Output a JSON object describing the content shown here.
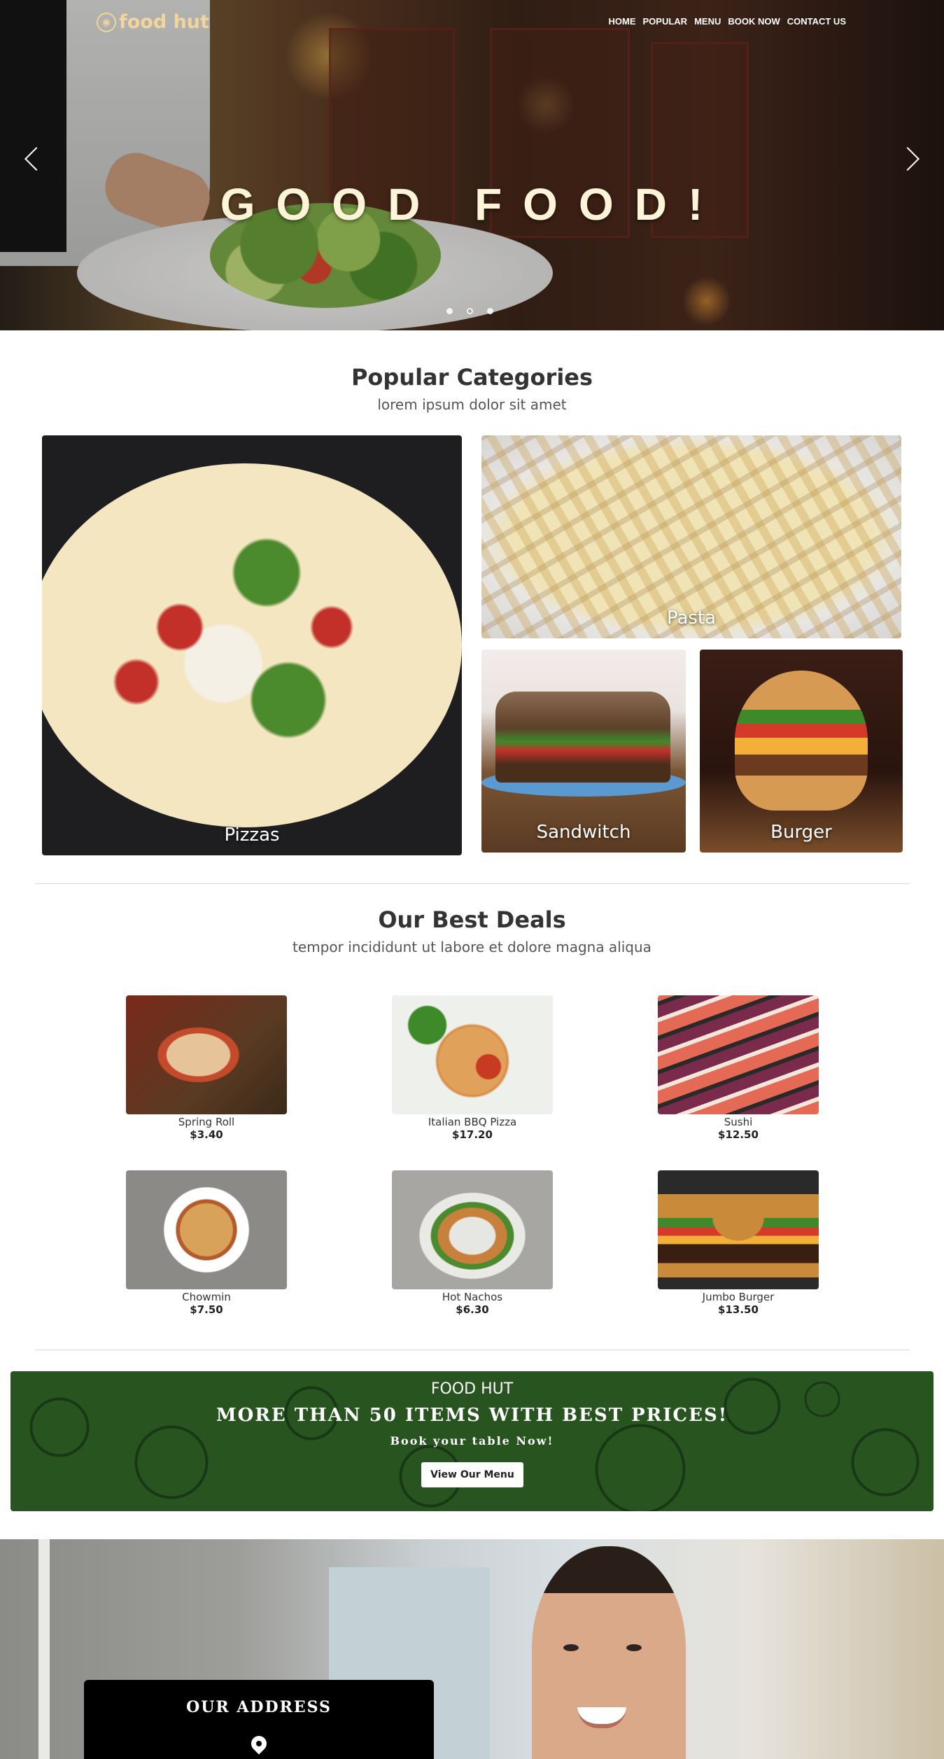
{
  "brand": {
    "logo_text": "food hut",
    "logo_icon": "chef-hat-icon",
    "accent": "#f3d49a"
  },
  "nav": {
    "items": [
      "HOME",
      "POPULAR",
      "MENU",
      "BOOK NOW",
      "CONTACT US"
    ]
  },
  "hero": {
    "title": "GOOD FOOD!",
    "slides": 3,
    "active_slide": 2
  },
  "popular": {
    "title": "Popular Categories",
    "subtitle": "lorem ipsum dolor sit amet",
    "categories": [
      "Pizzas",
      "Pasta",
      "Sandwitch",
      "Burger"
    ]
  },
  "deals": {
    "title": "Our Best Deals",
    "subtitle": "tempor incididunt ut labore et dolore magna aliqua",
    "items": [
      {
        "name": "Spring Roll",
        "price": "$3.40"
      },
      {
        "name": "Italian BBQ Pizza",
        "price": "$17.20"
      },
      {
        "name": "Sushi",
        "price": "$12.50"
      },
      {
        "name": "Chowmin",
        "price": "$7.50"
      },
      {
        "name": "Hot Nachos",
        "price": "$6.30"
      },
      {
        "name": "Jumbo Burger",
        "price": "$13.50"
      }
    ]
  },
  "banner": {
    "title": "FOOD HUT",
    "headline": "MORE THAN 50 ITEMS WITH BEST PRICES!",
    "subline": "Book your table Now!",
    "button": "View Our Menu",
    "color": "#285420"
  },
  "contact": {
    "address_title": "OUR ADDRESS",
    "pin_icon": "location-pin-icon"
  }
}
